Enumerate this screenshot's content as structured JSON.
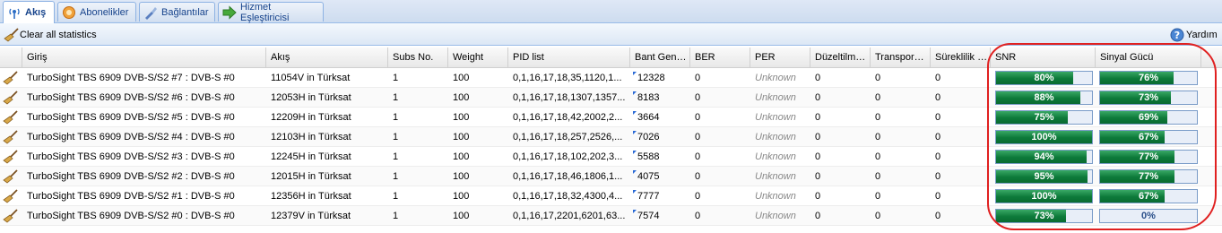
{
  "tabs": [
    {
      "label": "Akış",
      "icon": "antenna-icon",
      "active": true
    },
    {
      "label": "Abonelikler",
      "icon": "subscriptions-icon",
      "active": false
    },
    {
      "label": "Bağlantılar",
      "icon": "connections-icon",
      "active": false
    },
    {
      "label": "Hizmet Eşleştiricisi",
      "icon": "arrow-right-icon",
      "active": false
    }
  ],
  "toolbar": {
    "clear_label": "Clear all statistics",
    "help_label": "Yardım"
  },
  "columns": {
    "input": "Giriş",
    "stream": "Akış",
    "subs": "Subs No.",
    "weight": "Weight",
    "pids": "PID list",
    "bandwidth": "Bant Gen…",
    "ber": "BER",
    "per": "PER",
    "corrected": "Düzeltilm…",
    "transport": "Transpor…",
    "continuity": "Süreklilik …",
    "snr": "SNR",
    "signal": "Sinyal Gücü"
  },
  "colors": {
    "bar_fill": "#0d7a3a",
    "annotation": "#e02020",
    "tab_text": "#15428b"
  },
  "rows": [
    {
      "input": "TurboSight TBS 6909 DVB-S/S2 #7 : DVB-S #0",
      "stream": "11054V in Türksat",
      "subs": "1",
      "weight": "100",
      "pids": "0,1,16,17,18,35,1120,1...",
      "bandwidth": "12328",
      "ber": "0",
      "per": "Unknown",
      "corrected": "0",
      "transport": "0",
      "continuity": "0",
      "snr": 80,
      "snr_label": "80%",
      "signal": 76,
      "signal_label": "76%"
    },
    {
      "input": "TurboSight TBS 6909 DVB-S/S2 #6 : DVB-S #0",
      "stream": "12053H in Türksat",
      "subs": "1",
      "weight": "100",
      "pids": "0,1,16,17,18,1307,1357...",
      "bandwidth": "8183",
      "ber": "0",
      "per": "Unknown",
      "corrected": "0",
      "transport": "0",
      "continuity": "0",
      "snr": 88,
      "snr_label": "88%",
      "signal": 73,
      "signal_label": "73%"
    },
    {
      "input": "TurboSight TBS 6909 DVB-S/S2 #5 : DVB-S #0",
      "stream": "12209H in Türksat",
      "subs": "1",
      "weight": "100",
      "pids": "0,1,16,17,18,42,2002,2...",
      "bandwidth": "3664",
      "ber": "0",
      "per": "Unknown",
      "corrected": "0",
      "transport": "0",
      "continuity": "0",
      "snr": 75,
      "snr_label": "75%",
      "signal": 69,
      "signal_label": "69%"
    },
    {
      "input": "TurboSight TBS 6909 DVB-S/S2 #4 : DVB-S #0",
      "stream": "12103H in Türksat",
      "subs": "1",
      "weight": "100",
      "pids": "0,1,16,17,18,257,2526,...",
      "bandwidth": "7026",
      "ber": "0",
      "per": "Unknown",
      "corrected": "0",
      "transport": "0",
      "continuity": "0",
      "snr": 100,
      "snr_label": "100%",
      "signal": 67,
      "signal_label": "67%"
    },
    {
      "input": "TurboSight TBS 6909 DVB-S/S2 #3 : DVB-S #0",
      "stream": "12245H in Türksat",
      "subs": "1",
      "weight": "100",
      "pids": "0,1,16,17,18,102,202,3...",
      "bandwidth": "5588",
      "ber": "0",
      "per": "Unknown",
      "corrected": "0",
      "transport": "0",
      "continuity": "0",
      "snr": 94,
      "snr_label": "94%",
      "signal": 77,
      "signal_label": "77%"
    },
    {
      "input": "TurboSight TBS 6909 DVB-S/S2 #2 : DVB-S #0",
      "stream": "12015H in Türksat",
      "subs": "1",
      "weight": "100",
      "pids": "0,1,16,17,18,46,1806,1...",
      "bandwidth": "4075",
      "ber": "0",
      "per": "Unknown",
      "corrected": "0",
      "transport": "0",
      "continuity": "0",
      "snr": 95,
      "snr_label": "95%",
      "signal": 77,
      "signal_label": "77%"
    },
    {
      "input": "TurboSight TBS 6909 DVB-S/S2 #1 : DVB-S #0",
      "stream": "12356H in Türksat",
      "subs": "1",
      "weight": "100",
      "pids": "0,1,16,17,18,32,4300,4...",
      "bandwidth": "7777",
      "ber": "0",
      "per": "Unknown",
      "corrected": "0",
      "transport": "0",
      "continuity": "0",
      "snr": 100,
      "snr_label": "100%",
      "signal": 67,
      "signal_label": "67%"
    },
    {
      "input": "TurboSight TBS 6909 DVB-S/S2 #0 : DVB-S #0",
      "stream": "12379V in Türksat",
      "subs": "1",
      "weight": "100",
      "pids": "0,1,16,17,2201,6201,63...",
      "bandwidth": "7574",
      "ber": "0",
      "per": "Unknown",
      "corrected": "0",
      "transport": "0",
      "continuity": "0",
      "snr": 73,
      "snr_label": "73%",
      "signal": 0,
      "signal_label": "0%"
    }
  ]
}
